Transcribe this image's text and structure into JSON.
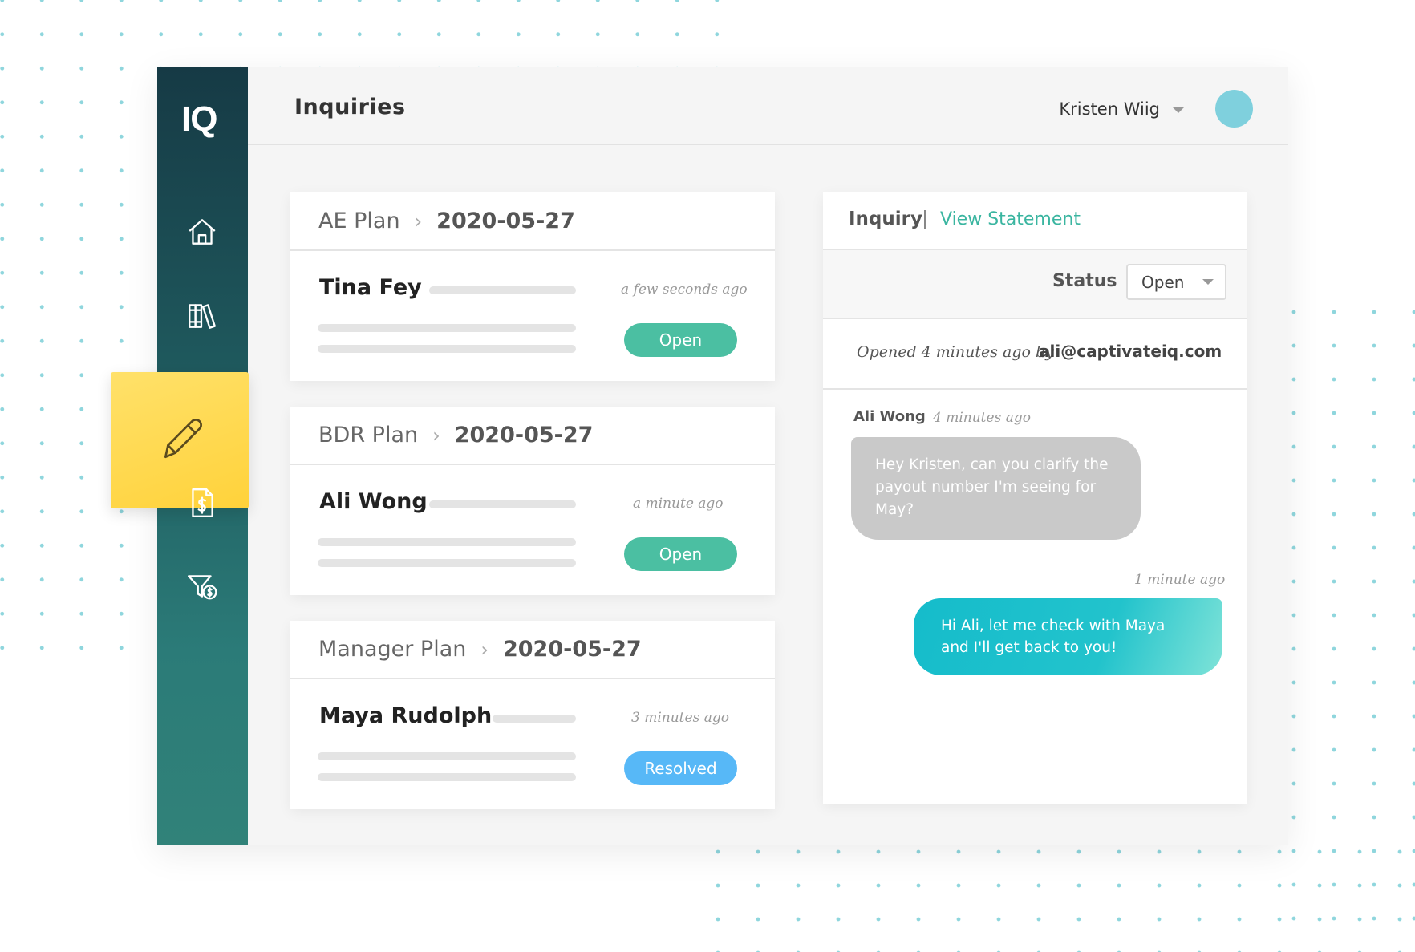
{
  "app": {
    "logo": "IQ",
    "page_title": "Inquiries"
  },
  "user": {
    "name": "Kristen Wiig"
  },
  "sidebar": {
    "items": [
      {
        "name": "home-icon",
        "active": false
      },
      {
        "name": "library-icon",
        "active": false
      },
      {
        "name": "pencil-icon",
        "active": true
      },
      {
        "name": "statement-icon",
        "active": false
      },
      {
        "name": "filter-dollar-icon",
        "active": false
      }
    ]
  },
  "inquiries": [
    {
      "plan": "AE Plan",
      "date": "2020-05-27",
      "person": "Tina Fey",
      "time": "a few seconds ago",
      "status": "Open",
      "status_color": "#4bbfa2"
    },
    {
      "plan": "BDR Plan",
      "date": "2020-05-27",
      "person": "Ali Wong",
      "time": "a minute ago",
      "status": "Open",
      "status_color": "#4bbfa2"
    },
    {
      "plan": "Manager Plan",
      "date": "2020-05-27",
      "person": "Maya Rudolph",
      "time": "3 minutes ago",
      "status": "Resolved",
      "status_color": "#57b8f7"
    }
  ],
  "detail": {
    "tab_inquiry": "Inquiry",
    "tab_view_statement": "View Statement",
    "status_label": "Status",
    "status_value": "Open",
    "opened_text": "Opened 4 minutes ago by",
    "opened_email": "ali@captivateiq.com",
    "messages": [
      {
        "author": "Ali Wong",
        "time": "4 minutes ago",
        "text": "Hey Kristen, can you clarify the payout number I'm seeing for May?"
      },
      {
        "author": "",
        "time": "1 minute ago",
        "text": "Hi Ali, let me check with Maya and I'll get back to you!"
      }
    ]
  },
  "colors": {
    "accent": "#3ab5a0",
    "active_nav": "#ffd23a",
    "sidebar_top": "#163a45",
    "sidebar_bottom": "#318279",
    "avatar": "#7fd0dd"
  }
}
